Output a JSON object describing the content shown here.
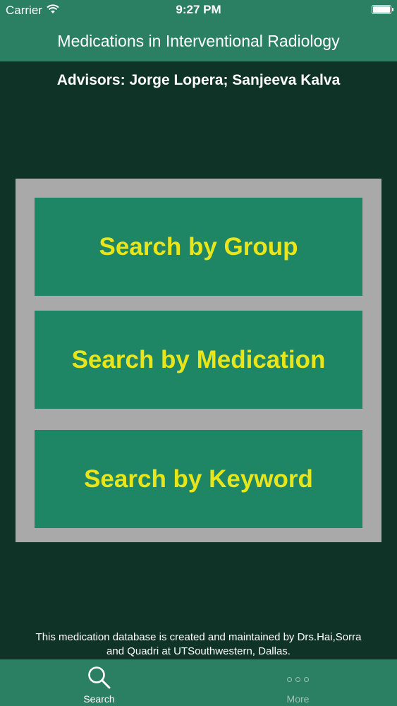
{
  "status_bar": {
    "carrier": "Carrier",
    "time": "9:27 PM"
  },
  "nav": {
    "title": "Medications in Interventional Radiology"
  },
  "advisors": "Advisors: Jorge Lopera; Sanjeeva Kalva",
  "buttons": [
    {
      "label": "Search by Group"
    },
    {
      "label": "Search by Medication"
    },
    {
      "label": "Search by Keyword"
    }
  ],
  "footer": {
    "line1": "This medication database is created and maintained by Drs.Hai,Sorra",
    "line2": "and Quadri at UTSouthwestern, Dallas."
  },
  "tabs": [
    {
      "label": "Search",
      "icon": "search-icon",
      "active": true
    },
    {
      "label": "More",
      "icon": "more-icon",
      "active": false
    }
  ],
  "colors": {
    "header_green": "#2b7f63",
    "background": "#0f3326",
    "button_green": "#1e8664",
    "button_text": "#e8e51b",
    "panel_gray": "#a9a9a9"
  }
}
